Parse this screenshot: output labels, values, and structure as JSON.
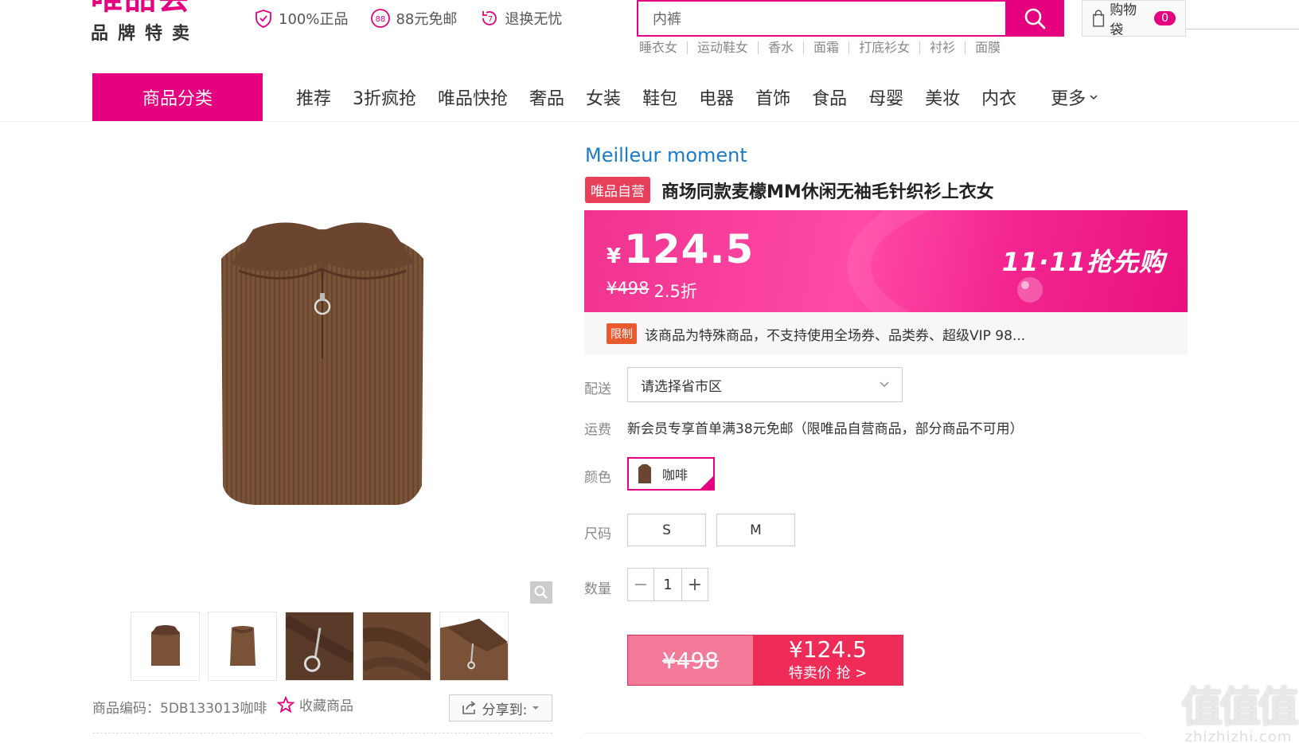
{
  "logo": {
    "main": "唯品会",
    "sub": "品牌特卖"
  },
  "promises": [
    {
      "icon": "shield-icon",
      "label": "100%正品"
    },
    {
      "icon": "badge-88-icon",
      "label": "88元免邮"
    },
    {
      "icon": "return-icon",
      "label": "退换无忧"
    }
  ],
  "search": {
    "value": "内裤",
    "hot_words": [
      "睡衣女",
      "运动鞋女",
      "香水",
      "面霜",
      "打底衫女",
      "衬衫",
      "面膜"
    ]
  },
  "cart": {
    "label": "购物袋",
    "count": "0"
  },
  "nav": {
    "category": "商品分类",
    "items": [
      "推荐",
      "3折疯抢",
      "唯品快抢",
      "奢品",
      "女装",
      "鞋包",
      "电器",
      "首饰",
      "食品",
      "母婴",
      "美妆",
      "内衣"
    ],
    "more": "更多"
  },
  "gallery": {
    "sku_code": "商品编码：5DB133013咖啡",
    "favorite": "收藏商品",
    "share": "分享到:"
  },
  "product": {
    "brand": "Meilleur moment",
    "badge": "唯品自营",
    "title": "商场同款麦檬MM休闲无袖毛针织衫上衣女",
    "currency": "¥",
    "price": "124.5",
    "original_price": "¥498",
    "discount": "2.5折",
    "promo": "11·11抢先购",
    "limit_badge": "限制",
    "limit_text": "该商品为特殊商品，不支持使用全场券、品类券、超级VIP 98...",
    "delivery_label": "配送",
    "region_placeholder": "请选择省市区",
    "shipping_label": "运费",
    "shipping_text": "新会员专享首单满38元免邮（限唯品自营商品，部分商品不可用）",
    "color_label": "颜色",
    "color_value": "咖啡",
    "size_label": "尺码",
    "sizes": [
      "S",
      "M"
    ],
    "quantity_label": "数量",
    "quantity": "1",
    "buy_original": "¥498",
    "buy_price": "¥124.5",
    "buy_label": "特卖价 抢 >"
  },
  "watermark": {
    "glyph": "值值值",
    "text": "zhizhizhi.com"
  },
  "colors": {
    "brand": "#e4007f",
    "link": "#1a7bc9",
    "buy": "#ef2c58"
  }
}
